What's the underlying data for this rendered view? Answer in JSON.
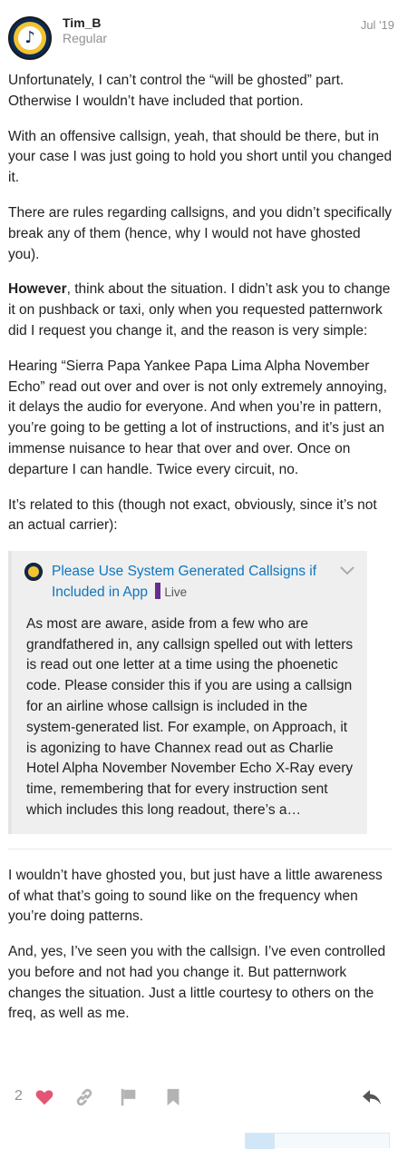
{
  "post": {
    "username": "Tim_B",
    "user_title": "Regular",
    "date": "Jul '19",
    "paragraphs": [
      "Unfortunately, I can’t control the “will be ghosted” part. Otherwise I wouldn’t have included that portion.",
      "With an offensive callsign, yeah, that should be there, but in your case I was just going to hold you short until you changed it.",
      "There are rules regarding callsigns, and you didn’t specifically break any of them (hence, why I would not have ghosted you)."
    ],
    "p4_bold": "However",
    "p4_rest": ", think about the situation. I didn’t ask you to change it on pushback or taxi, only when you requested patternwork did I request you change it, and the reason is very simple:",
    "p5": "Hearing “Sierra Papa Yankee Papa Lima Alpha November Echo” read out over and over is not only extremely annoying, it delays the audio for everyone. And when you’re in pattern, you’re going to be getting a lot of instructions, and it’s just an immense nuisance to hear that over and over. Once on departure I can handle. Twice every circuit, no.",
    "p6": "It’s related to this (though not exact, obviously, since it’s not an actual carrier):",
    "onebox": {
      "title": "Please Use System Generated Callsigns if Included in App",
      "category": "Live",
      "category_color": "#652d90",
      "icon": "team-logo-icon",
      "expand_icon": "chevron-down-icon",
      "excerpt": "As most are aware, aside from a few who are grandfathered in, any callsign spelled out with letters is read out one letter at a time using the phoenetic code. Please consider this if you are using a callsign for an airline whose callsign is included in the system-generated list. For example, on Approach, it is agonizing to have Channex read out as Charlie Hotel Alpha November November Echo X-Ray every time, remembering that for every instruction sent which includes this long readout, there’s a…"
    },
    "p7": "I wouldn’t have ghosted you, but just have a little awareness of what that’s going to sound like on the frequency when you’re doing patterns.",
    "p8": "And, yes, I’ve seen you with the callsign. I’ve even controlled you before and not had you change it. But patternwork changes the situation. Just a little courtesy to others on the freq, as well as me."
  },
  "actions": {
    "like_count": "2",
    "like_icon": "heart-icon",
    "link_icon": "link-icon",
    "flag_icon": "flag-icon",
    "bookmark_icon": "bookmark-icon",
    "reply_icon": "reply-icon",
    "heart_color": "#e45575"
  },
  "progress": {
    "fill_fraction": 0.2
  },
  "colors": {
    "link": "#0e76bd",
    "muted": "#919191",
    "text": "#222222"
  }
}
